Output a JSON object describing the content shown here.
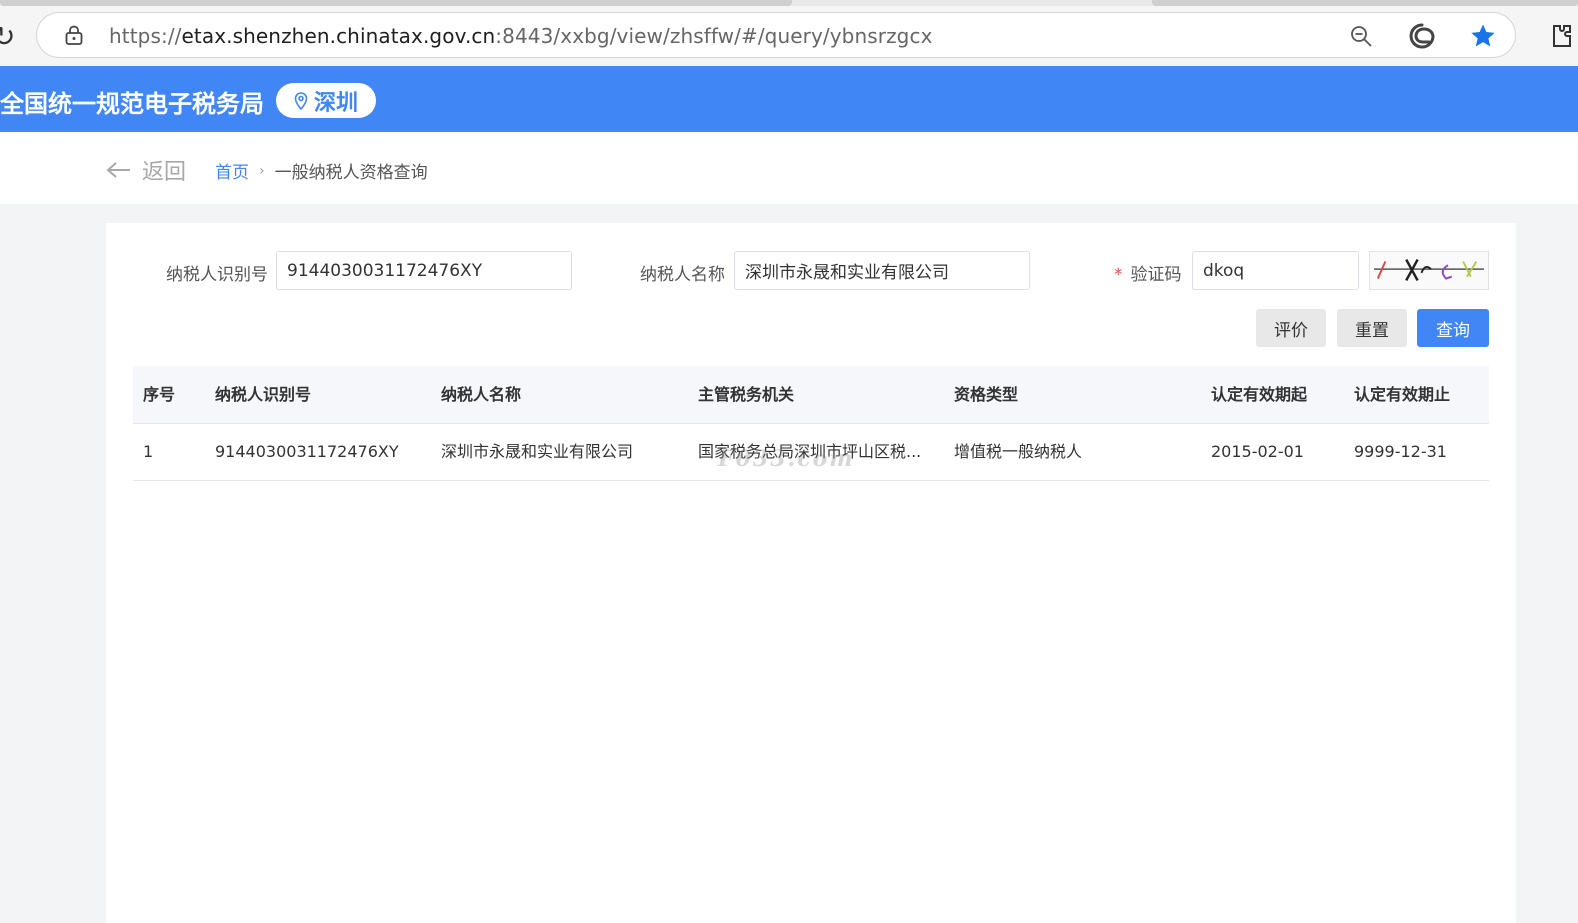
{
  "browser": {
    "url_scheme": "https://",
    "url_host": "etax.shenzhen.chinatax.gov.cn",
    "url_rest": ":8443/xxbg/view/zhsffw/#/query/ybnsrzgcx",
    "icons": [
      "reload-icon",
      "lock-icon",
      "zoom-out-icon",
      "edge-icon",
      "favorite-star-icon",
      "extensions-icon"
    ],
    "accent_color": "#1a73e8"
  },
  "header": {
    "title": "全国统一规范电子税务局",
    "city": "深圳",
    "background_color": "#4086f5"
  },
  "breadcrumb": {
    "back_label": "返回",
    "home": "首页",
    "separator": "›",
    "current": "一般纳税人资格查询"
  },
  "form": {
    "taxpayer_id_label": "纳税人识别号",
    "taxpayer_id_value": "9144030031172476XY",
    "taxpayer_name_label": "纳税人名称",
    "taxpayer_name_value": "深圳市永晟和实业有限公司",
    "captcha_required_mark": "*",
    "captcha_label": "验证码",
    "captcha_value": "dkoq"
  },
  "actions": {
    "evaluate": "评价",
    "reset": "重置",
    "query": "查询"
  },
  "table": {
    "columns": [
      "序号",
      "纳税人识别号",
      "纳税人名称",
      "主管税务机关",
      "资格类型",
      "认定有效期起",
      "认定有效期止"
    ],
    "rows": [
      [
        "1",
        "9144030031172476XY",
        "深圳市永晟和实业有限公司",
        "国家税务总局深圳市坪山区税...",
        "增值税一般纳税人",
        "2015-02-01",
        "9999-12-31"
      ]
    ]
  },
  "watermark": "F033.com"
}
